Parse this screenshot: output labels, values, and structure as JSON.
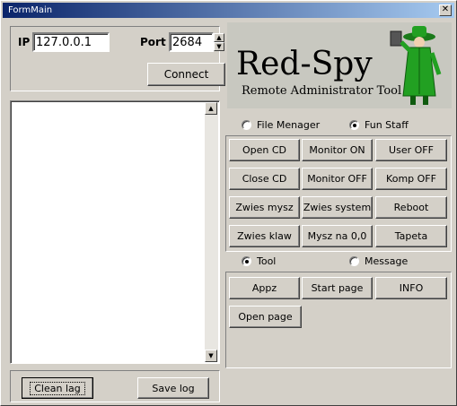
{
  "window": {
    "title": "FormMain",
    "close_glyph": "✕"
  },
  "connection": {
    "ip_label": "IP",
    "ip_value": "127.0.0.1",
    "port_label": "Port",
    "port_value": "2684",
    "connect_label": "Connect"
  },
  "logo": {
    "title": "Red-Spy",
    "subtitle": "Remote Administrator Tool",
    "mascot_icon": "spy-mascot-icon"
  },
  "fun_group": {
    "option_file": "File Menager",
    "option_fun": "Fun Staff",
    "selected": "Fun Staff"
  },
  "fun_buttons": [
    [
      "Open CD",
      "Monitor ON",
      "User OFF"
    ],
    [
      "Close CD",
      "Monitor OFF",
      "Komp OFF"
    ],
    [
      "Zwies mysz",
      "Zwies system",
      "Reboot"
    ],
    [
      "Zwies klaw",
      "Mysz na 0,0",
      "Tapeta"
    ]
  ],
  "tool_group": {
    "option_tool": "Tool",
    "option_message": "Message",
    "selected": "Tool"
  },
  "tool_buttons": [
    "Appz",
    "Start page",
    "INFO",
    "Open page"
  ],
  "log": {
    "clean_label": "Clean lag",
    "save_label": "Save log"
  },
  "colors": {
    "title_start": "#0a246a",
    "title_end": "#a6caf0",
    "logo_bg": "#c8c8c0",
    "mascot_green": "#22a022"
  }
}
